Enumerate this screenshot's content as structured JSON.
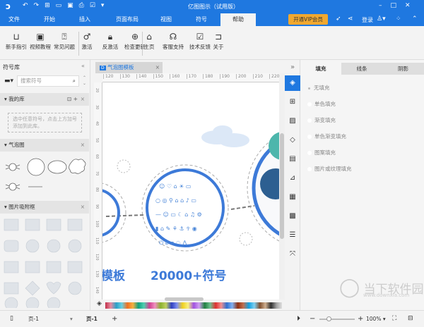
{
  "title": "亿图图示（试用版）",
  "menu_tabs": [
    "文件",
    "开始",
    "插入",
    "页面布局",
    "视图",
    "符号",
    "帮助"
  ],
  "vip_button": "开通VIP会员",
  "login": "登录",
  "ribbon": [
    {
      "label": "新手指引",
      "icon": "book-icon"
    },
    {
      "label": "视频教程",
      "icon": "video-icon"
    },
    {
      "label": "常见问题",
      "icon": "question-icon"
    },
    {
      "label": "激活",
      "icon": "key-icon"
    },
    {
      "label": "反激活",
      "icon": "lock-icon"
    },
    {
      "label": "检查更新",
      "icon": "upload-icon"
    },
    {
      "label": "主页",
      "icon": "home-icon"
    },
    {
      "label": "客服支持",
      "icon": "headset-icon"
    },
    {
      "label": "技术反馈",
      "icon": "edit-icon"
    },
    {
      "label": "关于",
      "icon": "about-icon"
    }
  ],
  "left": {
    "title": "符号库",
    "search_placeholder": "搜索符号",
    "my_lib": "我的库",
    "my_lib_hint": "选中任意符号，点击上方加号添加到此库。",
    "bubble": "气泡图",
    "picture": "图片吸附框"
  },
  "doc_tab": "气泡图模板",
  "ruler_h": [
    "120",
    "130",
    "140",
    "150",
    "160",
    "170",
    "180",
    "190",
    "200",
    "210",
    "220"
  ],
  "ruler_v": [
    "20",
    "30",
    "40",
    "50",
    "60",
    "70",
    "80",
    "90",
    "100",
    "110",
    "120",
    "130",
    "140"
  ],
  "canvas": {
    "text_left": "模板",
    "text_mid": "20000+符号"
  },
  "right": {
    "tabs": [
      "填充",
      "线条",
      "阴影"
    ],
    "options": [
      "无填充",
      "单色填充",
      "渐变填充",
      "单色渐变填充",
      "图案填充",
      "图片或纹理填充"
    ]
  },
  "status": {
    "page_select": "页-1",
    "page_tab": "页-1",
    "zoom": "100%"
  },
  "watermark": {
    "name": "当下软件园",
    "url": "www.downxia.com"
  },
  "colors": {
    "accent": "#1f78e0",
    "vip": "#f0a830",
    "shape_blue": "#3d7ad8"
  }
}
